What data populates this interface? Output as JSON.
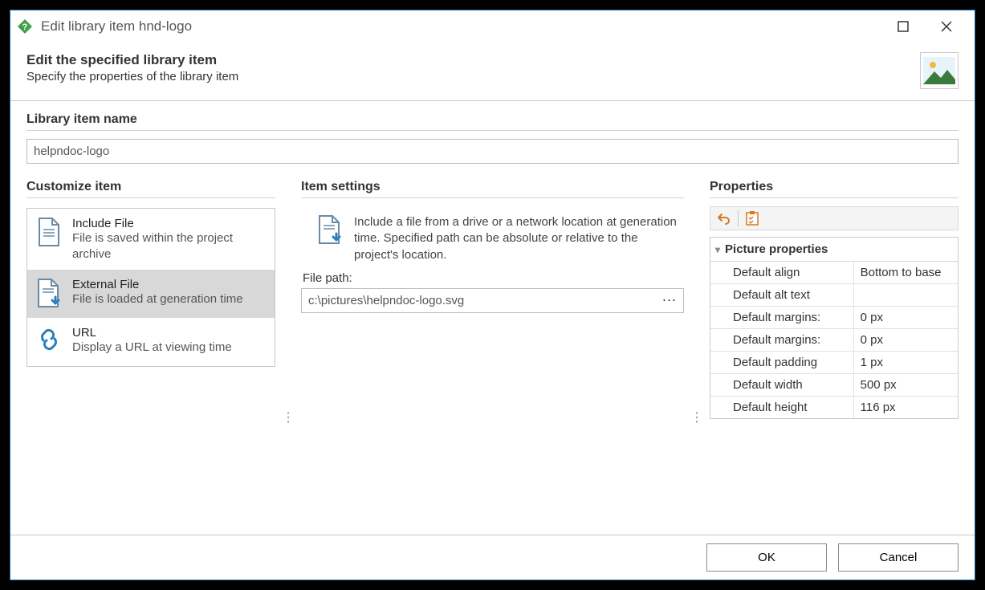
{
  "window": {
    "title": "Edit library item hnd-logo"
  },
  "header": {
    "title": "Edit the specified library item",
    "subtitle": "Specify the properties of the library item"
  },
  "name": {
    "label": "Library item name",
    "value": "helpndoc-logo"
  },
  "customize": {
    "label": "Customize item",
    "items": [
      {
        "title": "Include File",
        "desc": "File is saved within the project archive",
        "selected": false,
        "icon": "file"
      },
      {
        "title": "External File",
        "desc": "File is loaded at generation time",
        "selected": true,
        "icon": "file-arrow"
      },
      {
        "title": "URL",
        "desc": "Display a URL at viewing time",
        "selected": false,
        "icon": "link"
      }
    ]
  },
  "settings": {
    "label": "Item settings",
    "desc": "Include a file from a drive or a network location at generation time. Specified path can be absolute or relative to the project's location.",
    "filepath_label": "File path:",
    "filepath_value": "c:\\pictures\\helpndoc-logo.svg"
  },
  "properties": {
    "label": "Properties",
    "group": "Picture properties",
    "rows": [
      {
        "key": "Default align",
        "val": "Bottom to base"
      },
      {
        "key": "Default alt text",
        "val": ""
      },
      {
        "key": "Default margins:",
        "val": "0 px"
      },
      {
        "key": "Default margins:",
        "val": "0 px"
      },
      {
        "key": "Default padding",
        "val": "1 px"
      },
      {
        "key": "Default width",
        "val": "500 px"
      },
      {
        "key": "Default height",
        "val": "116 px"
      }
    ]
  },
  "footer": {
    "ok": "OK",
    "cancel": "Cancel"
  }
}
